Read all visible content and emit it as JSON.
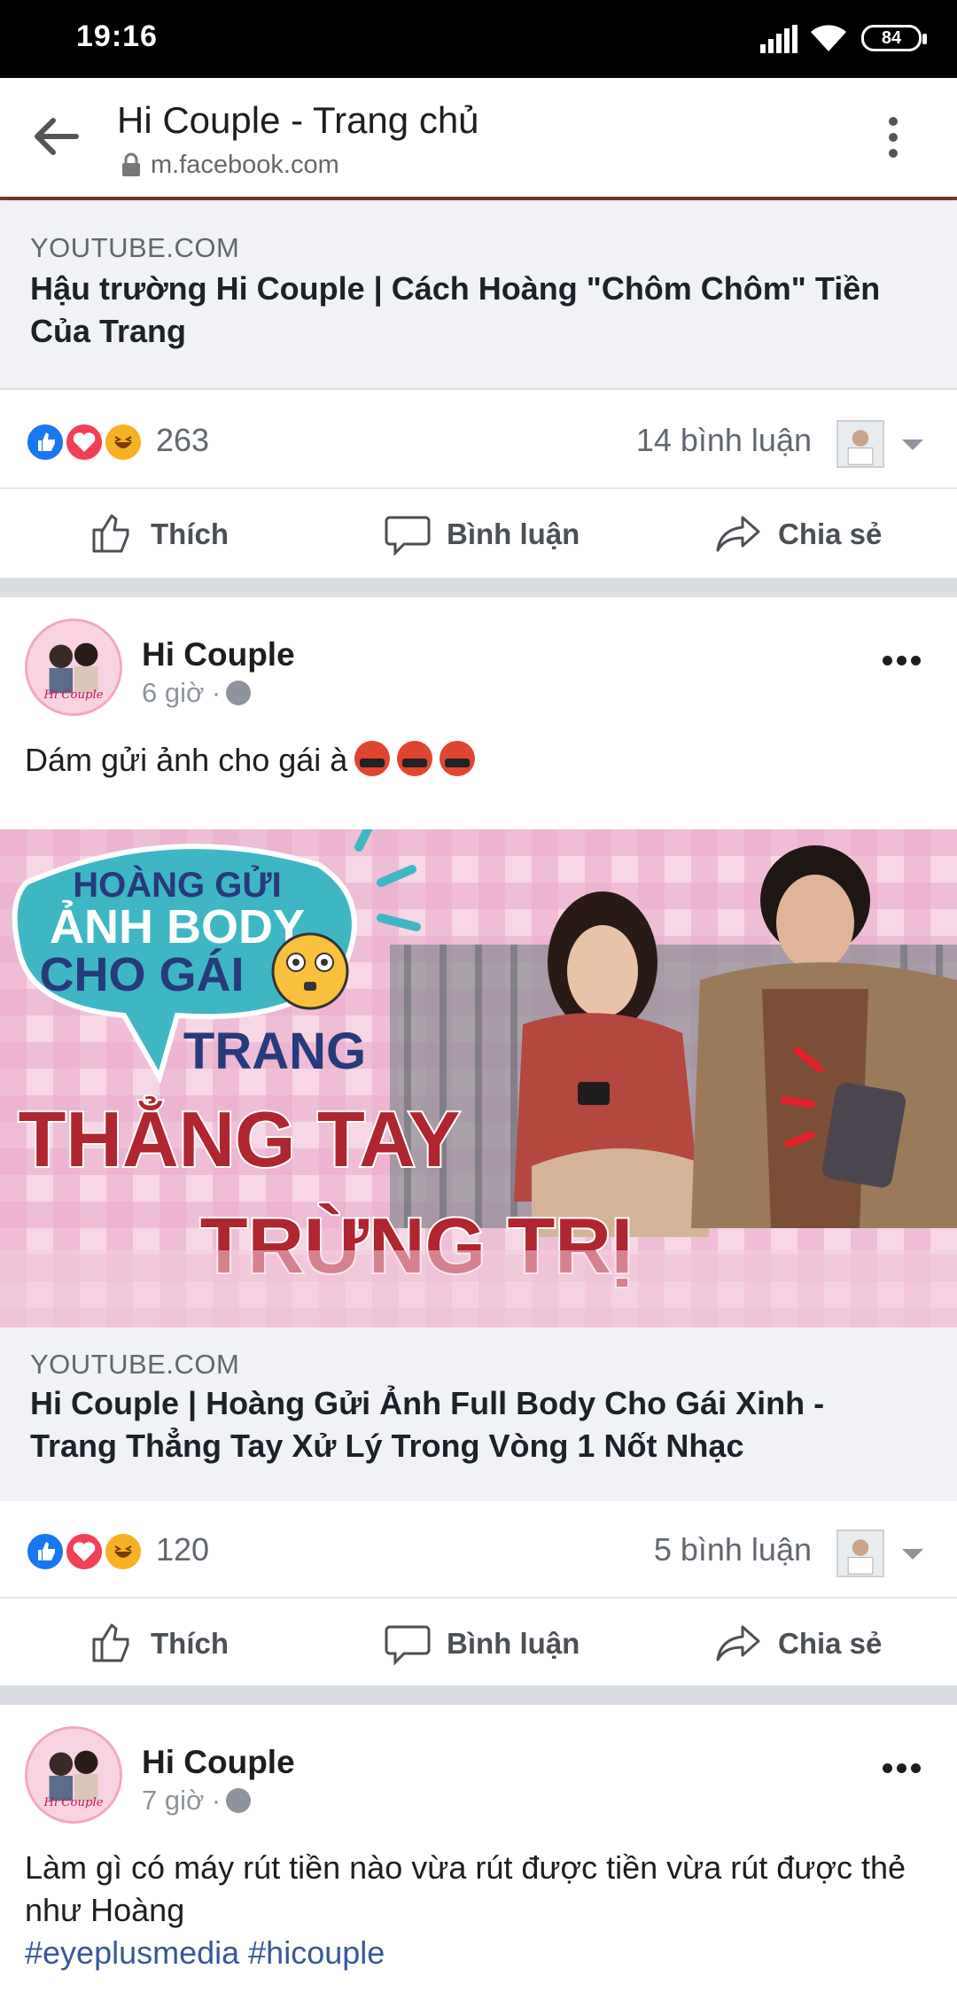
{
  "status_bar": {
    "time": "19:16",
    "battery": "84"
  },
  "browser": {
    "title": "Hi Couple - Trang chủ",
    "url": "m.facebook.com"
  },
  "feed": {
    "post1": {
      "link_domain": "YOUTUBE.COM",
      "link_title": "Hậu trường Hi Couple | Cách Hoàng \"Chôm Chôm\" Tiền Của Trang",
      "reaction_count": "263",
      "comments": "14 bình luận"
    },
    "post2": {
      "author": "Hi Couple",
      "time": "6 giờ ·",
      "text": "Dám gửi ảnh cho gái à",
      "thumbnail": {
        "line1": "HOÀNG GỬI",
        "line2": "ẢNH BODY",
        "line3": "CHO GÁI",
        "line4": "TRANG",
        "line5": "THẲNG TAY",
        "line6": "TRỪNG TRỊ"
      },
      "link_domain": "YOUTUBE.COM",
      "link_title": "Hi Couple | Hoàng Gửi Ảnh Full Body Cho Gái Xinh - Trang Thẳng Tay Xử Lý Trong Vòng 1 Nốt Nhạc",
      "reaction_count": "120",
      "comments": "5 bình luận"
    },
    "post3": {
      "author": "Hi Couple",
      "time": "7 giờ ·",
      "text": "Làm gì có máy rút tiền nào vừa rút được tiền vừa rút được thẻ như Hoàng",
      "hashtags": "#eyeplusmedia #hicouple"
    }
  },
  "actions": {
    "like": "Thích",
    "comment": "Bình luận",
    "share": "Chia sẻ"
  },
  "colors": {
    "facebook_blue": "#385898",
    "like_blue": "#1877f2",
    "love_red": "#f33e58",
    "haha_yellow": "#f7b125"
  }
}
